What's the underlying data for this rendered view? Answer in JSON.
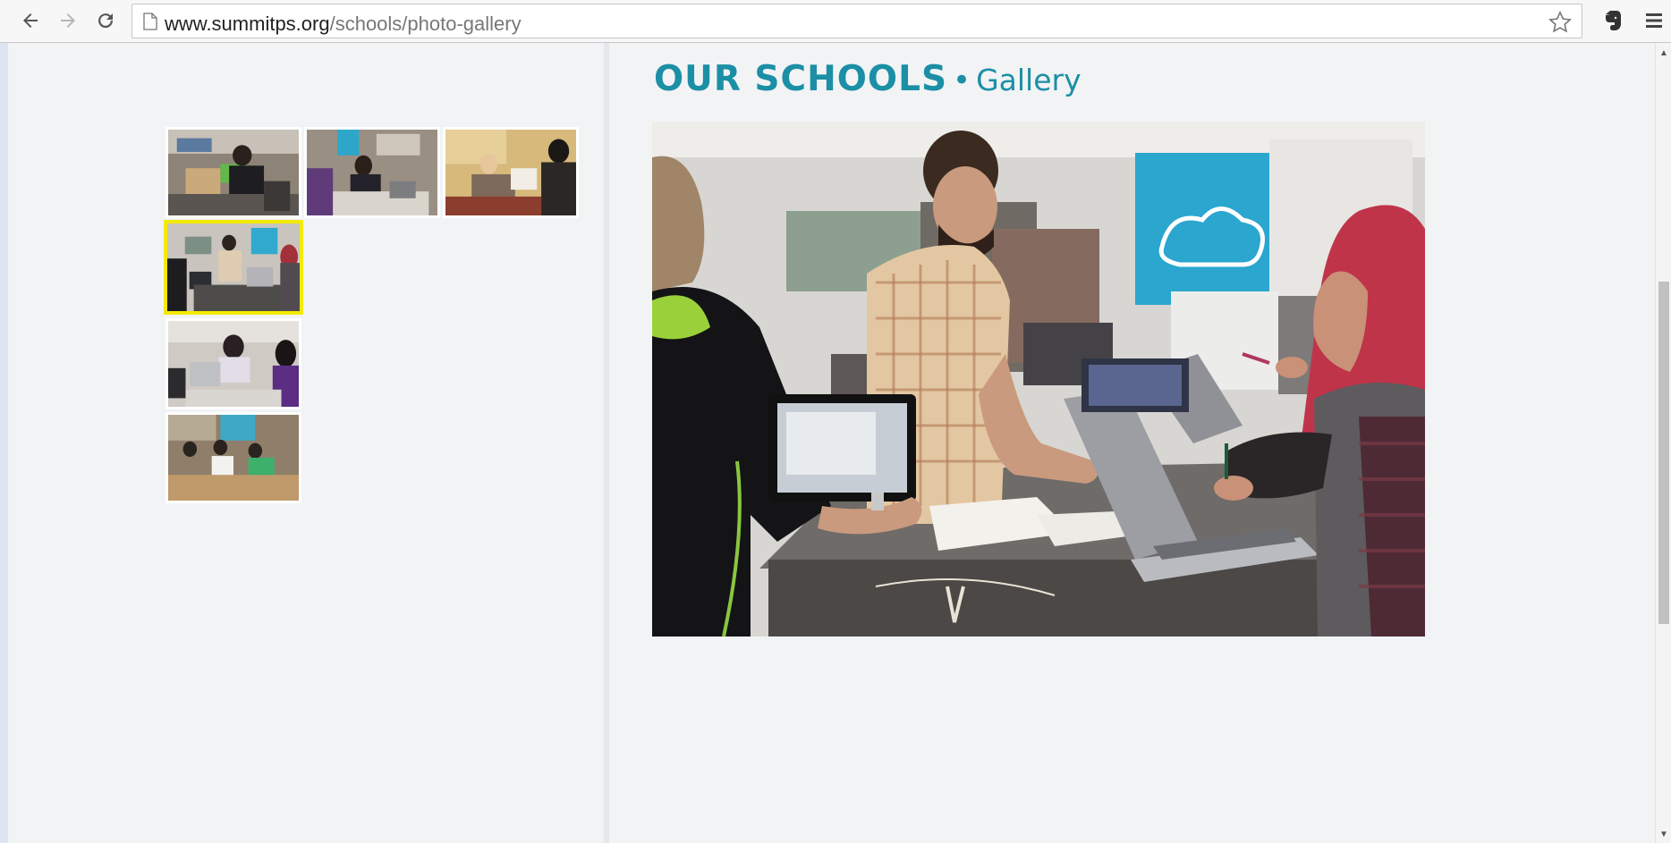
{
  "browser": {
    "url_domain": "www.summitps.org",
    "url_path": "/schools/photo-gallery",
    "icons": [
      "back-arrow-icon",
      "forward-arrow-icon",
      "reload-icon",
      "page-icon",
      "star-icon",
      "evernote-icon",
      "menu-icon"
    ]
  },
  "page": {
    "heading_main": "OUR SCHOOLS",
    "heading_separator": "•",
    "heading_sub": "Gallery",
    "accent_color": "#1b8fa5",
    "selected_thumb_color": "#f4ea00"
  },
  "gallery": {
    "thumbnail_count": 6,
    "selected_index": 3
  }
}
